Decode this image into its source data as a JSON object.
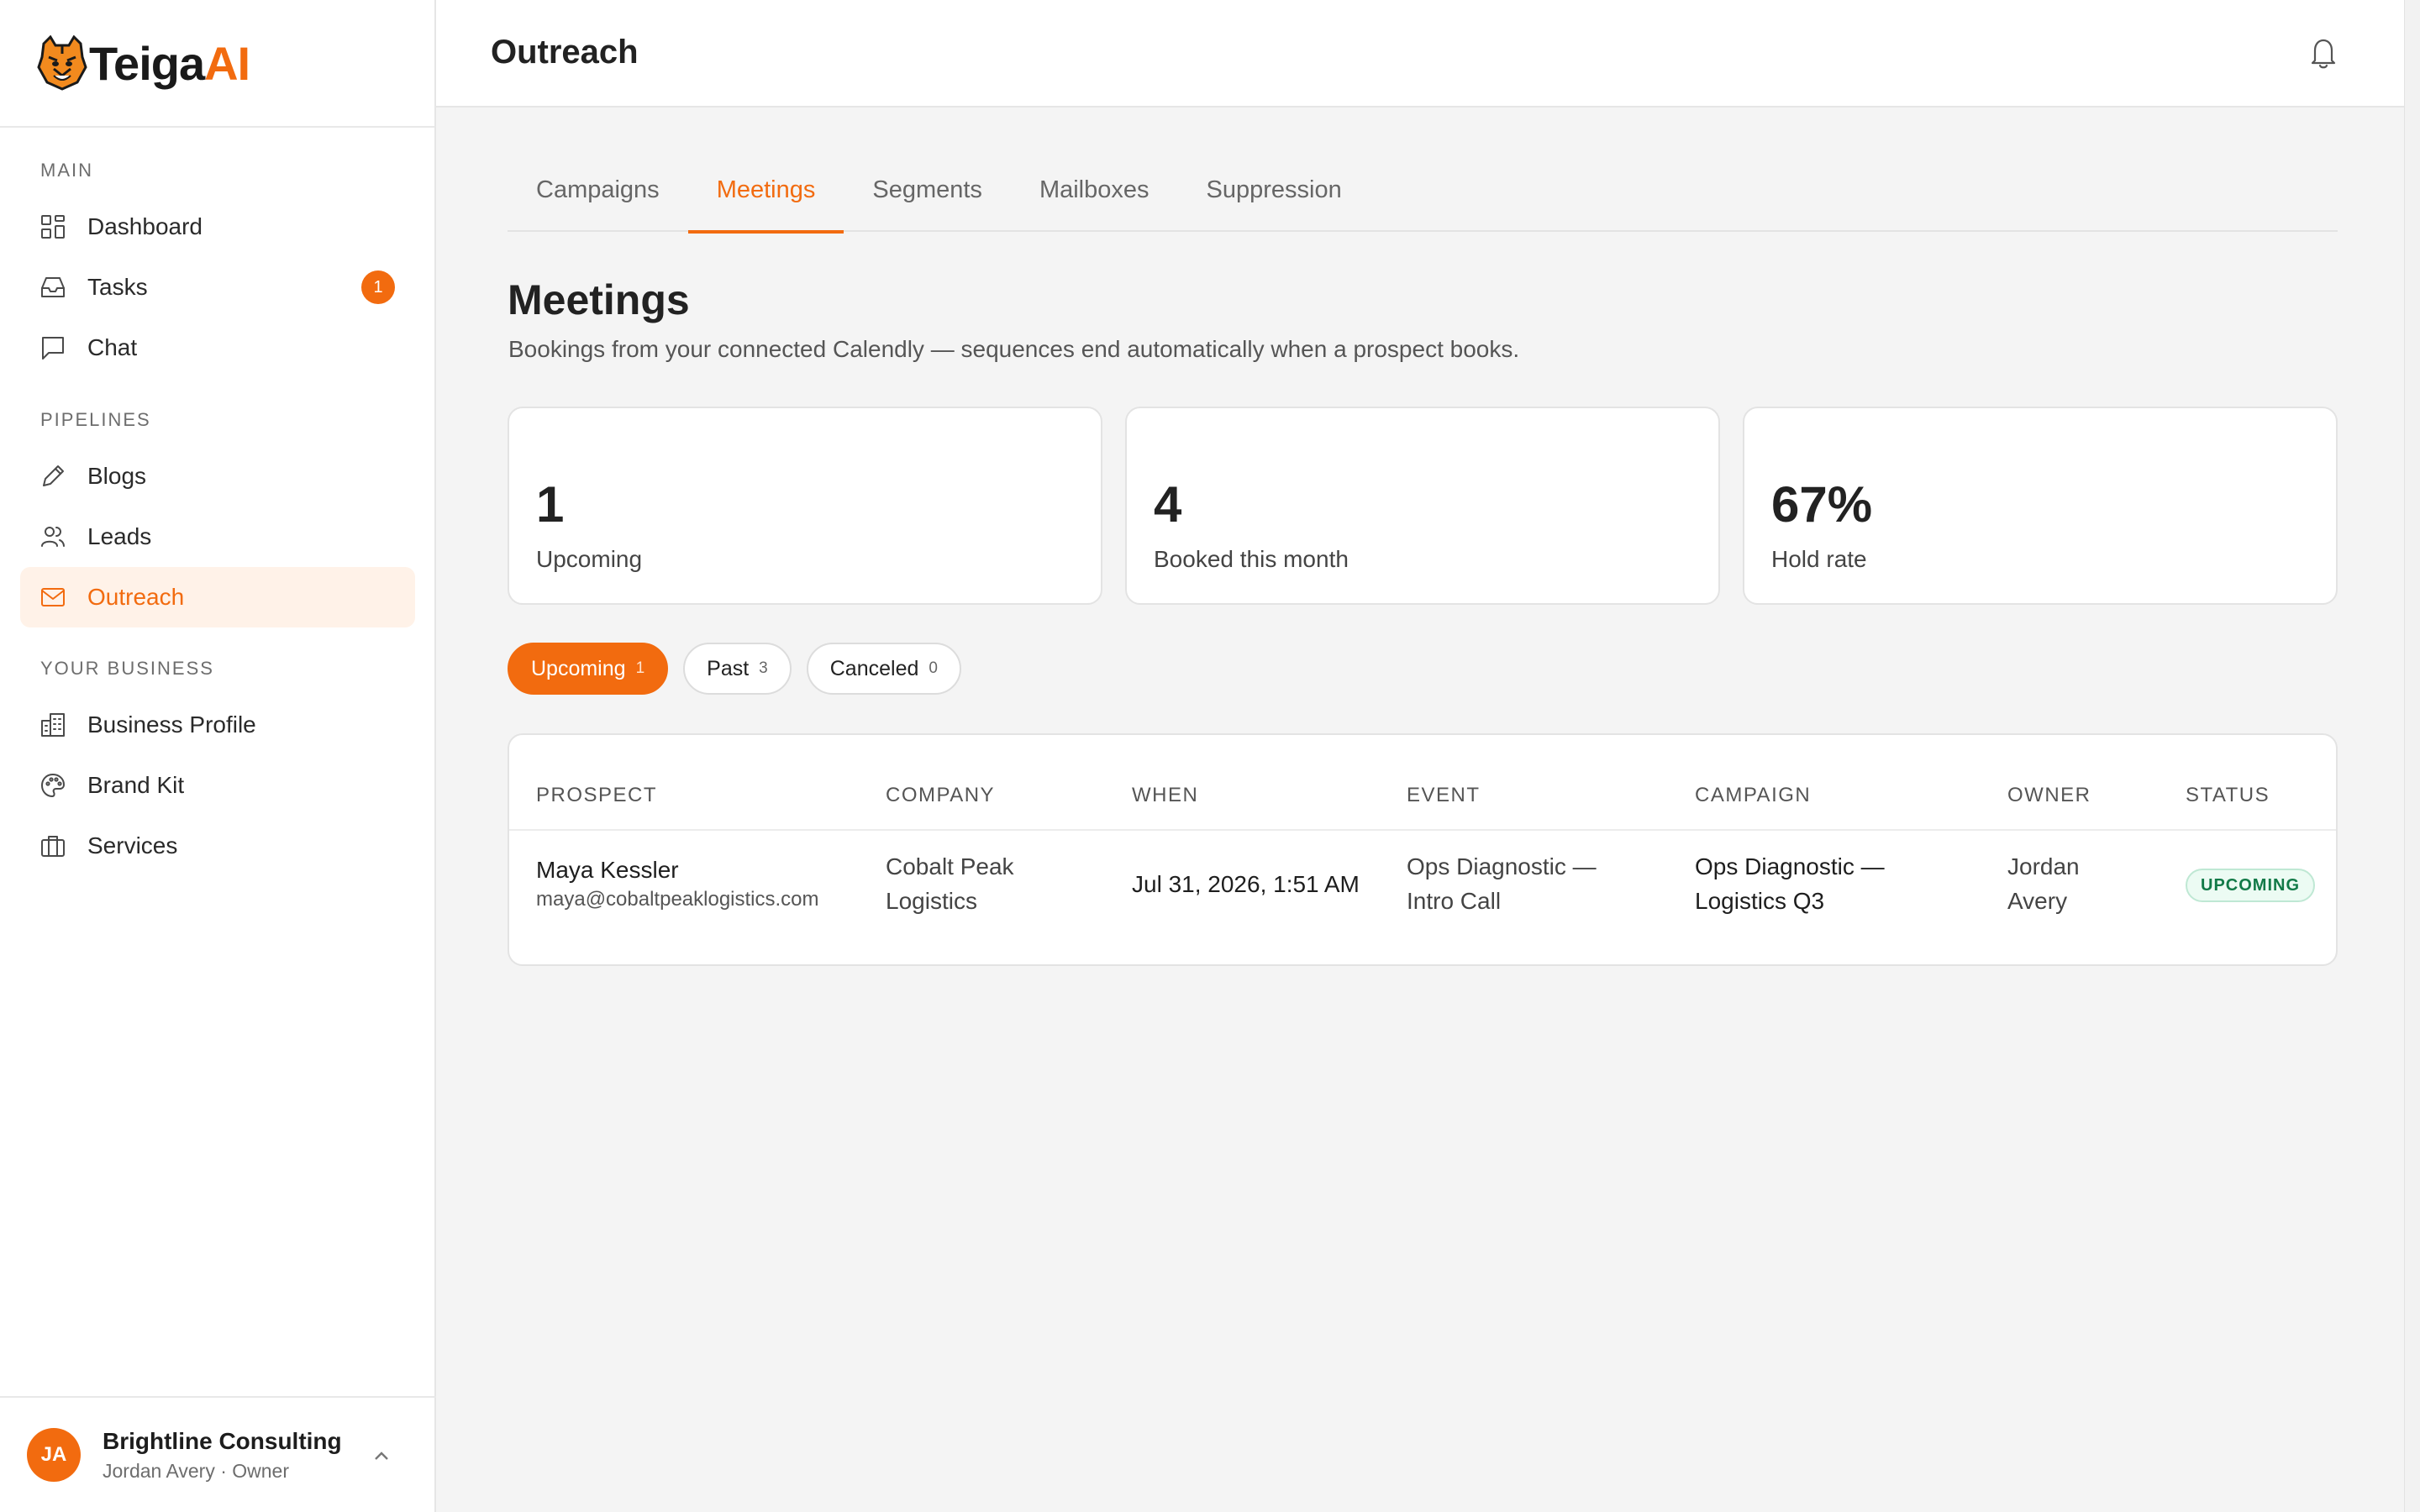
{
  "brand": {
    "name_part1": "Teiga",
    "name_part2": "AI"
  },
  "sidebar": {
    "sections": [
      {
        "label": "MAIN"
      },
      {
        "label": "PIPELINES"
      },
      {
        "label": "YOUR BUSINESS"
      }
    ],
    "items": [
      {
        "label": "Dashboard",
        "icon": "dashboard-icon"
      },
      {
        "label": "Tasks",
        "icon": "inbox-icon",
        "badge": "1"
      },
      {
        "label": "Chat",
        "icon": "chat-icon"
      },
      {
        "label": "Blogs",
        "icon": "pencil-icon"
      },
      {
        "label": "Leads",
        "icon": "users-icon"
      },
      {
        "label": "Outreach",
        "icon": "mail-icon",
        "active": true
      },
      {
        "label": "Business Profile",
        "icon": "building-icon"
      },
      {
        "label": "Brand Kit",
        "icon": "palette-icon"
      },
      {
        "label": "Services",
        "icon": "briefcase-icon"
      }
    ],
    "account": {
      "initials": "JA",
      "name": "Brightline Consulting",
      "role": "Jordan Avery · Owner"
    }
  },
  "header": {
    "title": "Outreach"
  },
  "tabs": [
    {
      "label": "Campaigns"
    },
    {
      "label": "Meetings",
      "active": true
    },
    {
      "label": "Segments"
    },
    {
      "label": "Mailboxes"
    },
    {
      "label": "Suppression"
    }
  ],
  "meetings": {
    "title": "Meetings",
    "subtitle": "Bookings from your connected Calendly — sequences end automatically when a prospect books.",
    "stats": [
      {
        "value": "1",
        "label": "Upcoming"
      },
      {
        "value": "4",
        "label": "Booked this month"
      },
      {
        "value": "67%",
        "label": "Hold rate"
      }
    ],
    "filters": [
      {
        "label": "Upcoming",
        "count": "1",
        "active": true
      },
      {
        "label": "Past",
        "count": "3"
      },
      {
        "label": "Canceled",
        "count": "0"
      }
    ],
    "table": {
      "columns": [
        "PROSPECT",
        "COMPANY",
        "WHEN",
        "EVENT",
        "CAMPAIGN",
        "OWNER",
        "STATUS"
      ],
      "rows": [
        {
          "prospect_name": "Maya Kessler",
          "prospect_email": "maya@cobaltpeaklogistics.com",
          "company_line1": "Cobalt Peak",
          "company_line2": "Logistics",
          "when": "Jul 31, 2026, 1:51 AM",
          "event_line1": "Ops Diagnostic —",
          "event_line2": "Intro Call",
          "campaign_line1": "Ops Diagnostic —",
          "campaign_line2": "Logistics Q3",
          "owner_line1": "Jordan",
          "owner_line2": "Avery",
          "status": "UPCOMING"
        }
      ]
    }
  },
  "colors": {
    "accent": "#f26b0f",
    "status_green": "#127a48"
  }
}
